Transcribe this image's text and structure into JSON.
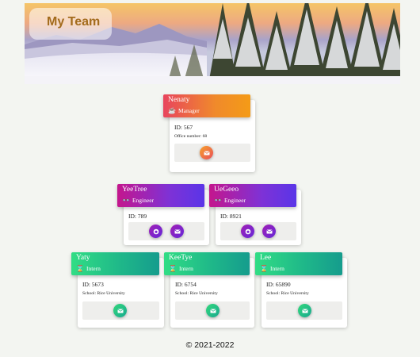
{
  "header": {
    "title": "My Team"
  },
  "team": {
    "manager": {
      "name": "Nenaty",
      "role": "Manager",
      "id_text": "ID: 567",
      "extra_text": "Office number: 68",
      "role_icon": "mug-icon",
      "buttons": [
        "email-icon"
      ]
    },
    "engineers": [
      {
        "name": "YeeTree",
        "role": "Engineer",
        "id_text": "ID: 789",
        "role_icon": "glasses-icon",
        "buttons": [
          "github-icon",
          "email-icon"
        ]
      },
      {
        "name": "UeGeeo",
        "role": "Engineer",
        "id_text": "ID: 8921",
        "role_icon": "glasses-icon",
        "buttons": [
          "github-icon",
          "email-icon"
        ]
      }
    ],
    "interns": [
      {
        "name": "Yaty",
        "role": "Intern",
        "id_text": "ID: 5673",
        "extra_text": "School: Rice University",
        "role_icon": "graduation-icon",
        "buttons": [
          "email-icon"
        ]
      },
      {
        "name": "KeeTye",
        "role": "Intern",
        "id_text": "ID: 6754",
        "extra_text": "School: Rice University",
        "role_icon": "graduation-icon",
        "buttons": [
          "email-icon"
        ]
      },
      {
        "name": "Lee",
        "role": "Intern",
        "id_text": "ID: 65890",
        "extra_text": "School: Rice University",
        "role_icon": "graduation-icon",
        "buttons": [
          "email-icon"
        ]
      }
    ]
  },
  "footer": {
    "copyright": "© 2021-2022"
  },
  "colors": {
    "manager_gradient": [
      "#e8455d",
      "#f49b17"
    ],
    "engineer_gradient": [
      "#c4168d",
      "#5a35e8"
    ],
    "intern_gradient": [
      "#31dd85",
      "#159c8d"
    ],
    "background": "#f3f5f1"
  }
}
